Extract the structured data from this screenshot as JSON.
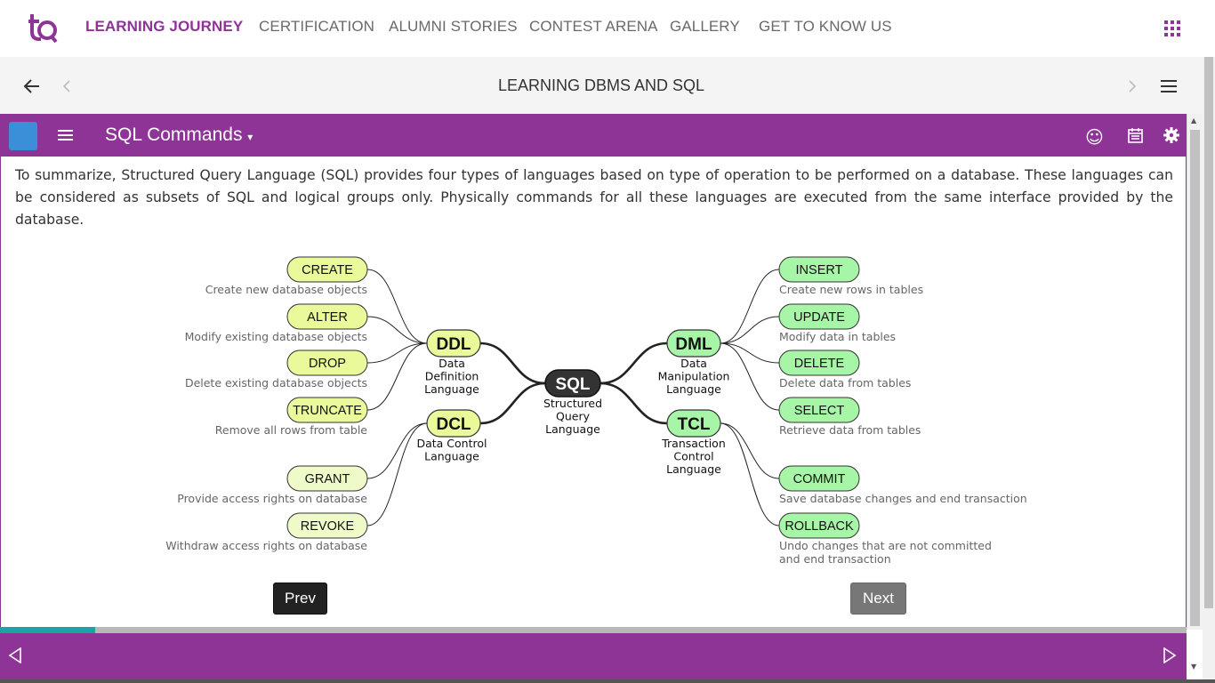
{
  "nav": {
    "items": [
      "LEARNING JOURNEY",
      "CERTIFICATION",
      "ALUMNI STORIES",
      "CONTEST ARENA",
      "GALLERY",
      "GET TO KNOW US"
    ],
    "active_index": 0,
    "logo_text": "tQ"
  },
  "course": {
    "title": "LEARNING DBMS AND SQL"
  },
  "lesson": {
    "title": "SQL Commands",
    "summary": "To summarize, Structured Query Language (SQL) provides four types of languages based on type of operation to be performed on a database. These languages can be considered as subsets of SQL and logical groups only. Physically commands for all these languages are executed from the same interface provided by the database."
  },
  "diagram": {
    "center": {
      "label": "SQL",
      "caption": [
        "Structured",
        "Query",
        "Language"
      ]
    },
    "groups": [
      {
        "label": "DDL",
        "caption": [
          "Data",
          "Definition",
          "Language"
        ],
        "side": "left",
        "color": "#eaf99a",
        "commands": [
          {
            "label": "CREATE",
            "desc": [
              "Create new database objects"
            ]
          },
          {
            "label": "ALTER",
            "desc": [
              "Modify existing database objects"
            ]
          },
          {
            "label": "DROP",
            "desc": [
              "Delete existing database objects"
            ]
          },
          {
            "label": "TRUNCATE",
            "desc": [
              "Remove all rows from table"
            ]
          }
        ]
      },
      {
        "label": "DCL",
        "caption": [
          "Data Control",
          "Language"
        ],
        "side": "left",
        "color": "#eaf99a",
        "commands": [
          {
            "label": "GRANT",
            "desc": [
              "Provide access rights on database"
            ]
          },
          {
            "label": "REVOKE",
            "desc": [
              "Withdraw access rights on database"
            ]
          }
        ]
      },
      {
        "label": "DML",
        "caption": [
          "Data",
          "Manipulation",
          "Language"
        ],
        "side": "right",
        "color": "#a7f5a7",
        "commands": [
          {
            "label": "INSERT",
            "desc": [
              "Create new rows in tables"
            ]
          },
          {
            "label": "UPDATE",
            "desc": [
              "Modify data in tables"
            ]
          },
          {
            "label": "DELETE",
            "desc": [
              "Delete data from tables"
            ]
          },
          {
            "label": "SELECT",
            "desc": [
              "Retrieve data from tables"
            ]
          }
        ]
      },
      {
        "label": "TCL",
        "caption": [
          "Transaction",
          "Control",
          "Language"
        ],
        "side": "right",
        "color": "#a7f5a7",
        "commands": [
          {
            "label": "COMMIT",
            "desc": [
              "Save database changes and end transaction"
            ]
          },
          {
            "label": "ROLLBACK",
            "desc": [
              "Undo changes that are not committed",
              "and end transaction"
            ]
          }
        ]
      }
    ]
  },
  "buttons": {
    "prev": "Prev",
    "next": "Next"
  },
  "progress": {
    "fraction": 0.08
  },
  "colors": {
    "brand": "#8e3496",
    "progress": "#1aa3a3"
  }
}
